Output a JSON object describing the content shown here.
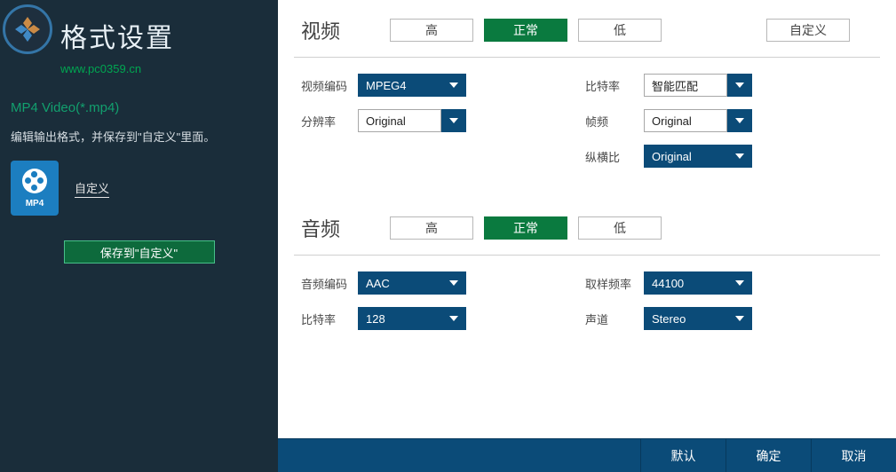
{
  "title": "格式设置",
  "site_url": "www.pc0359.cn",
  "format_name": "MP4 Video(*.mp4)",
  "description": "编辑输出格式，并保存到\"自定义\"里面。",
  "preset": {
    "icon_text": "MP4",
    "label": "自定义"
  },
  "save_custom_btn": "保存到\"自定义\"",
  "video": {
    "title": "视频",
    "tabs": {
      "high": "高",
      "normal": "正常",
      "low": "低",
      "custom": "自定义"
    },
    "fields": {
      "codec": {
        "label": "视频编码",
        "value": "MPEG4"
      },
      "resolution": {
        "label": "分辨率",
        "value": "Original"
      },
      "bitrate": {
        "label": "比特率",
        "value": "智能匹配"
      },
      "framerate": {
        "label": "帧频",
        "value": "Original"
      },
      "aspect": {
        "label": "纵横比",
        "value": "Original"
      }
    }
  },
  "audio": {
    "title": "音频",
    "tabs": {
      "high": "高",
      "normal": "正常",
      "low": "低"
    },
    "fields": {
      "codec": {
        "label": "音频编码",
        "value": "AAC"
      },
      "bitrate": {
        "label": "比特率",
        "value": "128"
      },
      "samplerate": {
        "label": "取样频率",
        "value": "44100"
      },
      "channel": {
        "label": "声道",
        "value": "Stereo"
      }
    }
  },
  "footer": {
    "default": "默认",
    "ok": "确定",
    "cancel": "取消"
  }
}
